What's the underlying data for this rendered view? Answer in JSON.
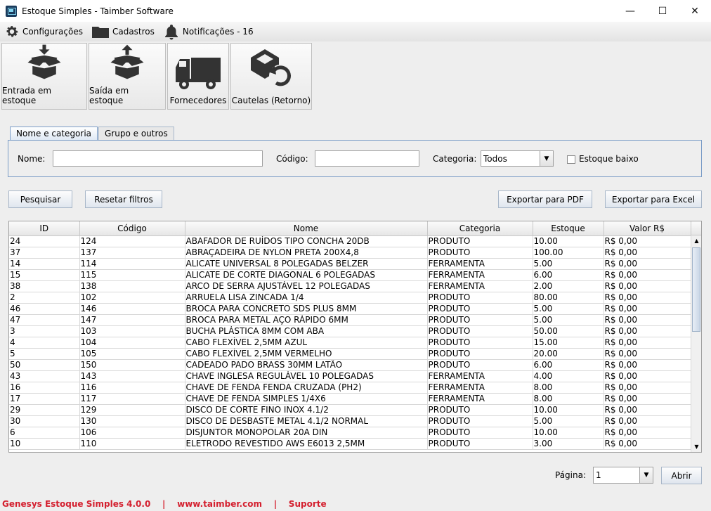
{
  "window": {
    "title": "Estoque Simples - Taimber Software",
    "minimize": "—",
    "maximize": "☐",
    "close": "✕"
  },
  "menu": [
    {
      "label": "Configurações",
      "icon": "gear-icon"
    },
    {
      "label": "Cadastros",
      "icon": "folder-icon"
    },
    {
      "label": "Notificações - 16",
      "icon": "bell-icon"
    }
  ],
  "toolbar": {
    "entrada": "Entrada em estoque",
    "saida": "Saída em estoque",
    "fornecedores": "Fornecedores",
    "cautelas": "Cautelas (Retorno)"
  },
  "tabs": {
    "nome_categoria": "Nome e categoria",
    "grupo_outros": "Grupo e outros"
  },
  "filters": {
    "nome_label": "Nome:",
    "nome_value": "",
    "codigo_label": "Código:",
    "codigo_value": "",
    "categoria_label": "Categoria:",
    "categoria_value": "Todos",
    "estoque_baixo_label": "Estoque baixo"
  },
  "buttons": {
    "pesquisar": "Pesquisar",
    "resetar": "Resetar filtros",
    "exportar_pdf": "Exportar para PDF",
    "exportar_excel": "Exportar para Excel",
    "abrir": "Abrir"
  },
  "table": {
    "columns": [
      "ID",
      "Código",
      "Nome",
      "Categoria",
      "Estoque",
      "Valor R$"
    ],
    "rows": [
      [
        "24",
        "124",
        "ABAFADOR DE RUÍDOS TIPO CONCHA 20DB",
        "PRODUTO",
        "10.00",
        "R$ 0,00"
      ],
      [
        "37",
        "137",
        "ABRAÇADEIRA DE NYLON PRETA 200X4,8",
        "PRODUTO",
        "100.00",
        "R$ 0,00"
      ],
      [
        "14",
        "114",
        "ALICATE UNIVERSAL 8 POLEGADAS BELZER",
        "FERRAMENTA",
        "5.00",
        "R$ 0,00"
      ],
      [
        "15",
        "115",
        "ALICATE DE CORTE DIAGONAL 6 POLEGADAS",
        "FERRAMENTA",
        "6.00",
        "R$ 0,00"
      ],
      [
        "38",
        "138",
        "ARCO DE SERRA AJUSTÁVEL 12 POLEGADAS",
        "FERRAMENTA",
        "2.00",
        "R$ 0,00"
      ],
      [
        "2",
        "102",
        "ARRUELA LISA ZINCADA 1/4",
        "PRODUTO",
        "80.00",
        "R$ 0,00"
      ],
      [
        "46",
        "146",
        "BROCA PARA CONCRETO SDS PLUS 8MM",
        "PRODUTO",
        "5.00",
        "R$ 0,00"
      ],
      [
        "47",
        "147",
        "BROCA PARA METAL AÇO RÁPIDO 6MM",
        "PRODUTO",
        "5.00",
        "R$ 0,00"
      ],
      [
        "3",
        "103",
        "BUCHA PLÁSTICA 8MM COM ABA",
        "PRODUTO",
        "50.00",
        "R$ 0,00"
      ],
      [
        "4",
        "104",
        "CABO FLEXÍVEL 2,5MM AZUL",
        "PRODUTO",
        "15.00",
        "R$ 0,00"
      ],
      [
        "5",
        "105",
        "CABO FLEXÍVEL 2,5MM VERMELHO",
        "PRODUTO",
        "20.00",
        "R$ 0,00"
      ],
      [
        "50",
        "150",
        "CADEADO PADO BRASS 30MM LATÃO",
        "PRODUTO",
        "6.00",
        "R$ 0,00"
      ],
      [
        "43",
        "143",
        "CHAVE INGLESA REGULÁVEL 10 POLEGADAS",
        "FERRAMENTA",
        "4.00",
        "R$ 0,00"
      ],
      [
        "16",
        "116",
        "CHAVE DE FENDA FENDA CRUZADA (PH2)",
        "FERRAMENTA",
        "8.00",
        "R$ 0,00"
      ],
      [
        "17",
        "117",
        "CHAVE DE FENDA SIMPLES 1/4X6",
        "FERRAMENTA",
        "8.00",
        "R$ 0,00"
      ],
      [
        "29",
        "129",
        "DISCO DE CORTE FINO INOX 4.1/2",
        "PRODUTO",
        "10.00",
        "R$ 0,00"
      ],
      [
        "30",
        "130",
        "DISCO DE DESBASTE METAL 4.1/2 NORMAL",
        "PRODUTO",
        "5.00",
        "R$ 0,00"
      ],
      [
        "6",
        "106",
        "DISJUNTOR MONOPOLAR 20A DIN",
        "PRODUTO",
        "10.00",
        "R$ 0,00"
      ],
      [
        "10",
        "110",
        "ELETRODO REVESTIDO AWS E6013 2,5MM",
        "PRODUTO",
        "3.00",
        "R$ 0,00"
      ]
    ]
  },
  "pagination": {
    "label": "Página:",
    "value": "1"
  },
  "footer": {
    "app": "Genesys Estoque Simples 4.0.0",
    "sep1": "    |    ",
    "site": "www.taimber.com",
    "sep2": "    |    ",
    "support": "Suporte"
  },
  "colors": {
    "footer_text": "#d4202f",
    "tab_border": "#7a9cc7"
  }
}
